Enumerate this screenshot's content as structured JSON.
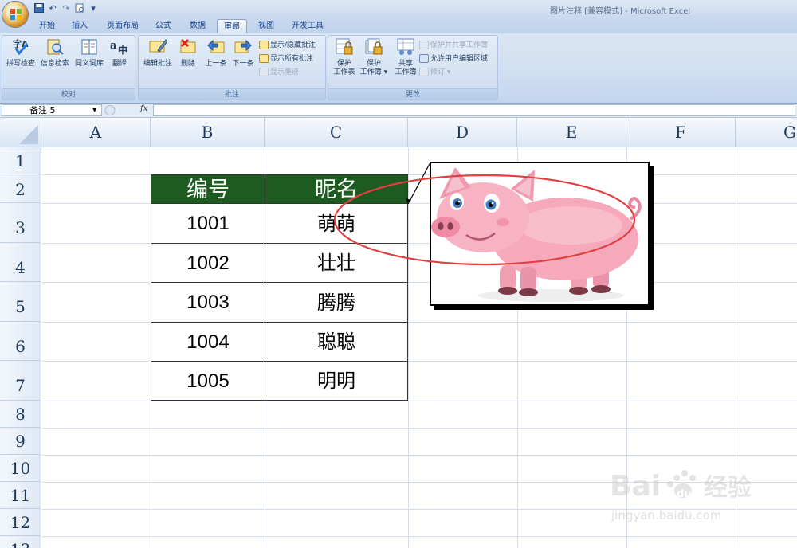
{
  "window": {
    "title": "图片注释  [兼容模式] - Microsoft Excel"
  },
  "tabs": [
    "开始",
    "插入",
    "页面布局",
    "公式",
    "数据",
    "审阅",
    "视图",
    "开发工具"
  ],
  "active_tab": "审阅",
  "ribbon": {
    "groups": {
      "proofing": {
        "label": "校对",
        "buttons": [
          "拼写检查",
          "信息检索",
          "同义词库",
          "翻译"
        ]
      },
      "comments": {
        "label": "批注",
        "buttons": [
          "编辑批注",
          "删除",
          "上一条",
          "下一条"
        ],
        "small": [
          "显示/隐藏批注",
          "显示所有批注",
          "显示墨迹"
        ]
      },
      "changes": {
        "label": "更改",
        "protect_sheet": [
          "保护",
          "工作表"
        ],
        "protect_workbook": [
          "保护",
          "工作簿"
        ],
        "share_workbook": [
          "共享",
          "工作簿"
        ],
        "small": [
          "保护并共享工作簿",
          "允许用户编辑区域",
          "修订"
        ]
      }
    }
  },
  "formula_bar": {
    "name_box": "备注 5",
    "fx": "fx",
    "value": ""
  },
  "columns": [
    "A",
    "B",
    "C",
    "D",
    "E",
    "F",
    "G"
  ],
  "rows": [
    "1",
    "2",
    "3",
    "4",
    "5",
    "6",
    "7",
    "8",
    "9",
    "10",
    "11",
    "12",
    "13"
  ],
  "table": {
    "headers": [
      "编号",
      "昵名"
    ],
    "rows": [
      [
        "1001",
        "萌萌"
      ],
      [
        "1002",
        "壮壮"
      ],
      [
        "1003",
        "腾腾"
      ],
      [
        "1004",
        "聪聪"
      ],
      [
        "1005",
        "明明"
      ]
    ]
  },
  "comment": {
    "image": "pig-illustration"
  },
  "watermark": {
    "brand": "Bai du 经验",
    "url": "jingyan.baidu.com"
  },
  "colors": {
    "header_fill": "#1e5b20",
    "annotation_ellipse": "#e04040"
  }
}
